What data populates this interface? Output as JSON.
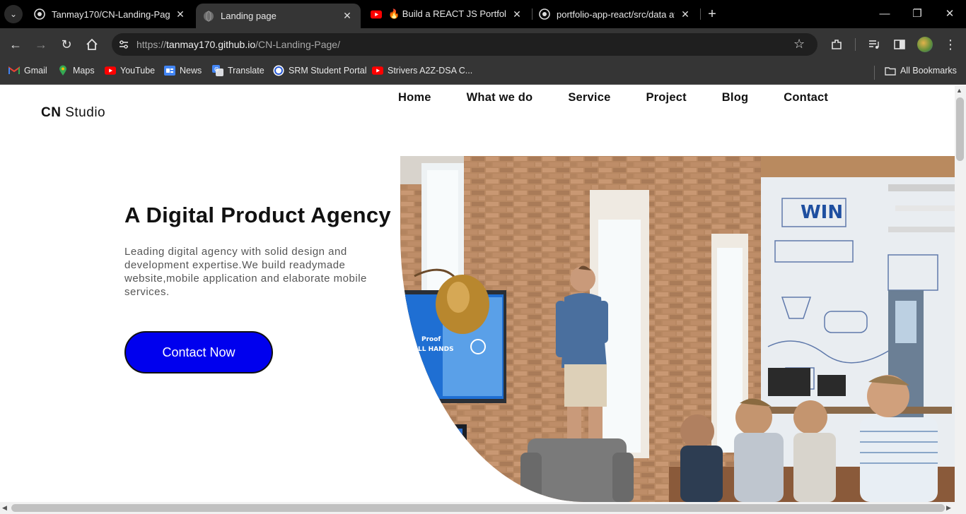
{
  "browser": {
    "tabs": [
      {
        "title": "Tanmay170/CN-Landing-Page",
        "icon": "github-icon",
        "active": false
      },
      {
        "title": "Landing page",
        "icon": "globe-icon",
        "active": true
      },
      {
        "title": "🔥 Build a REACT JS Portfolio W",
        "icon": "youtube-icon",
        "active": false
      },
      {
        "title": "portfolio-app-react/src/data at",
        "icon": "github-icon",
        "active": false
      }
    ],
    "address": {
      "scheme": "https://",
      "host": "tanmay170.github.io",
      "path": "/CN-Landing-Page/"
    },
    "bookmarks": [
      {
        "label": "Gmail",
        "icon": "gmail-icon"
      },
      {
        "label": "Maps",
        "icon": "maps-icon"
      },
      {
        "label": "YouTube",
        "icon": "youtube-icon"
      },
      {
        "label": "News",
        "icon": "news-icon"
      },
      {
        "label": "Translate",
        "icon": "translate-icon"
      },
      {
        "label": "SRM Student Portal",
        "icon": "portal-icon"
      },
      {
        "label": "Strivers A2Z-DSA C...",
        "icon": "youtube-icon"
      }
    ],
    "all_bookmarks_label": "All Bookmarks"
  },
  "page": {
    "logo": {
      "bold": "CN",
      "rest": " Studio"
    },
    "nav": [
      "Home",
      "What we do",
      "Service",
      "Project",
      "Blog",
      "Contact"
    ],
    "hero": {
      "title": "A Digital Product Agency",
      "text": "Leading digital agency with solid design and development expertise.We build readymade website,mobile application and elaborate mobile services.",
      "cta": "Contact Now",
      "cta_color": "#0000ee"
    },
    "image_texts": {
      "sign": "WIN",
      "screen_line1": "Proof",
      "screen_line2": "ALL HANDS"
    }
  }
}
